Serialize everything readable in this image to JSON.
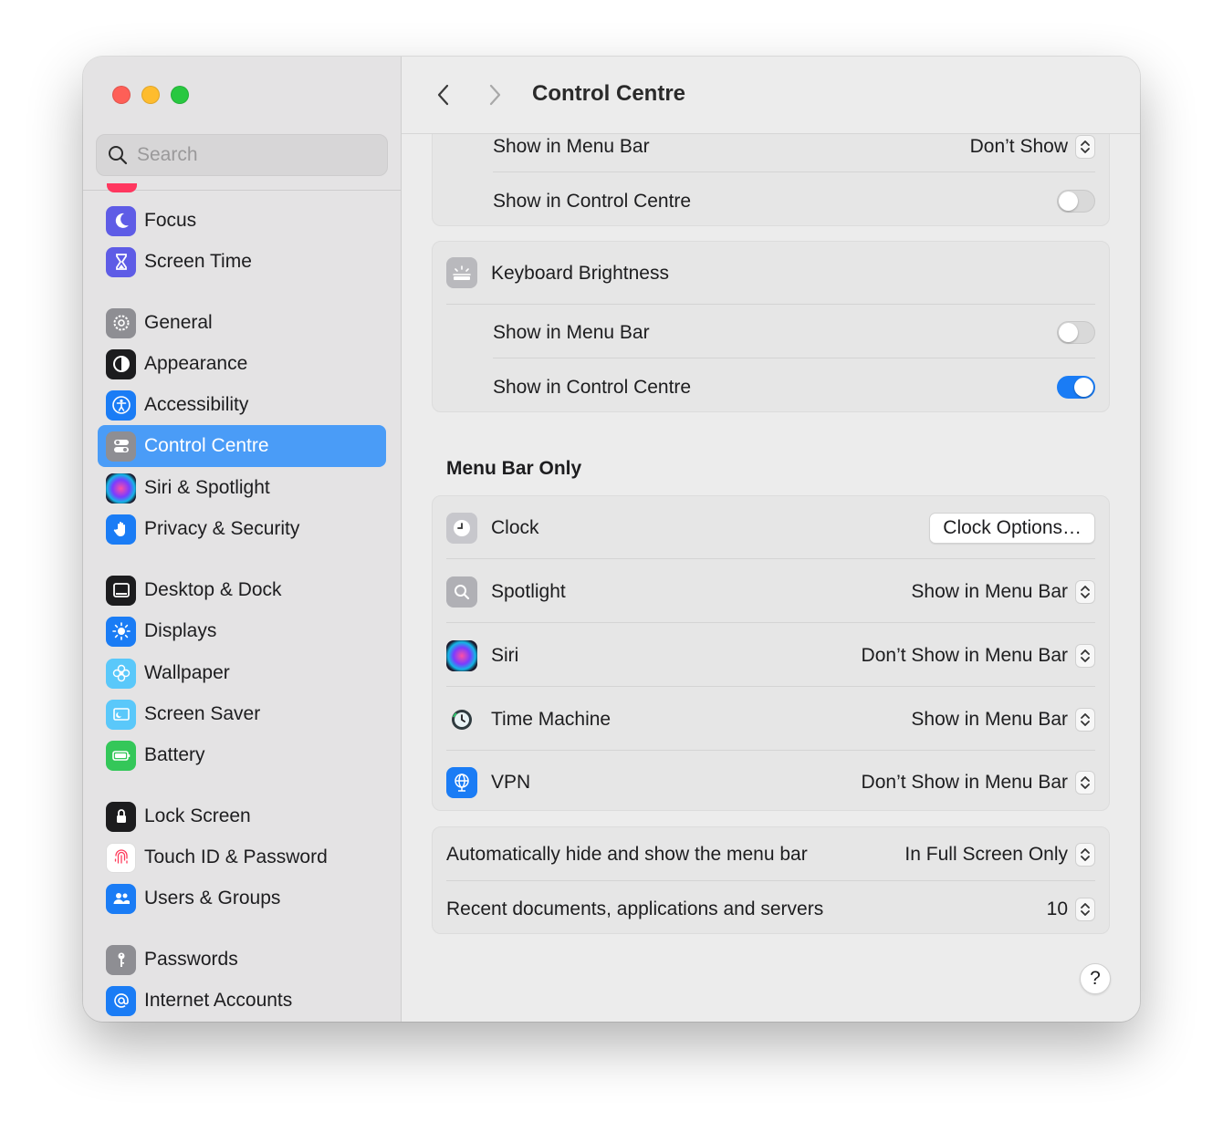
{
  "window": {
    "title": "Control Centre"
  },
  "search": {
    "placeholder": "Search"
  },
  "sidebar": {
    "items": [
      {
        "label": "Focus",
        "icon": "moon-icon",
        "color": "#5e5ce6"
      },
      {
        "label": "Screen Time",
        "icon": "hourglass-icon",
        "color": "#5e5ce6"
      },
      {
        "label": "General",
        "icon": "gear-icon",
        "color": "#8e8e93"
      },
      {
        "label": "Appearance",
        "icon": "appearance-icon",
        "color": "#1c1c1e"
      },
      {
        "label": "Accessibility",
        "icon": "accessibility-icon",
        "color": "#1a7cf5"
      },
      {
        "label": "Control Centre",
        "icon": "control-centre-icon",
        "color": "#8e8e93",
        "selected": true
      },
      {
        "label": "Siri & Spotlight",
        "icon": "siri-icon",
        "color": "#2c2c54"
      },
      {
        "label": "Privacy & Security",
        "icon": "hand-icon",
        "color": "#1a7cf5"
      },
      {
        "label": "Desktop & Dock",
        "icon": "dock-icon",
        "color": "#1c1c1e"
      },
      {
        "label": "Displays",
        "icon": "sun-icon",
        "color": "#1a7cf5"
      },
      {
        "label": "Wallpaper",
        "icon": "flower-icon",
        "color": "#5ac8fa"
      },
      {
        "label": "Screen Saver",
        "icon": "screen-saver-icon",
        "color": "#5ac8fa"
      },
      {
        "label": "Battery",
        "icon": "battery-icon",
        "color": "#34c759"
      },
      {
        "label": "Lock Screen",
        "icon": "lock-icon",
        "color": "#1c1c1e"
      },
      {
        "label": "Touch ID & Password",
        "icon": "fingerprint-icon",
        "color": "#ffffff"
      },
      {
        "label": "Users & Groups",
        "icon": "users-icon",
        "color": "#1a7cf5"
      },
      {
        "label": "Passwords",
        "icon": "key-icon",
        "color": "#8e8e93"
      },
      {
        "label": "Internet Accounts",
        "icon": "at-icon",
        "color": "#1a7cf5"
      }
    ]
  },
  "top_card": {
    "show_in_menu_bar_label": "Show in Menu Bar",
    "show_in_menu_bar_value": "Don’t Show",
    "show_in_control_centre_label": "Show in Control Centre",
    "show_in_control_centre_on": false
  },
  "keyboard_brightness": {
    "title": "Keyboard Brightness",
    "show_in_menu_bar_label": "Show in Menu Bar",
    "show_in_menu_bar_on": false,
    "show_in_control_centre_label": "Show in Control Centre",
    "show_in_control_centre_on": true
  },
  "menu_bar_only": {
    "section_title": "Menu Bar Only",
    "clock": {
      "label": "Clock",
      "button": "Clock Options…"
    },
    "spotlight": {
      "label": "Spotlight",
      "value": "Show in Menu Bar"
    },
    "siri": {
      "label": "Siri",
      "value": "Don’t Show in Menu Bar"
    },
    "time_machine": {
      "label": "Time Machine",
      "value": "Show in Menu Bar"
    },
    "vpn": {
      "label": "VPN",
      "value": "Don’t Show in Menu Bar"
    }
  },
  "menu_bar_settings": {
    "auto_hide_label": "Automatically hide and show the menu bar",
    "auto_hide_value": "In Full Screen Only",
    "recent_label": "Recent documents, applications and servers",
    "recent_value": "10"
  },
  "help": {
    "label": "?"
  },
  "colors": {
    "accent": "#1a7cf5",
    "selection": "#4a9cf7"
  }
}
